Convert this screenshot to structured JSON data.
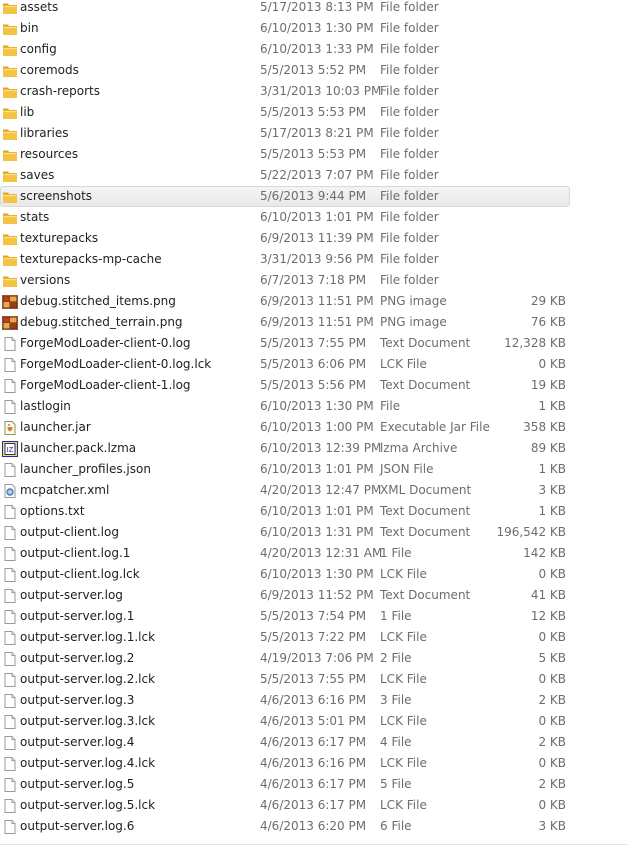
{
  "files": [
    {
      "name": "assets",
      "date": "5/17/2013 8:13 PM",
      "type": "File folder",
      "size": "",
      "icon": "folder-icon"
    },
    {
      "name": "bin",
      "date": "6/10/2013 1:30 PM",
      "type": "File folder",
      "size": "",
      "icon": "folder-icon"
    },
    {
      "name": "config",
      "date": "6/10/2013 1:33 PM",
      "type": "File folder",
      "size": "",
      "icon": "folder-icon"
    },
    {
      "name": "coremods",
      "date": "5/5/2013 5:52 PM",
      "type": "File folder",
      "size": "",
      "icon": "folder-icon"
    },
    {
      "name": "crash-reports",
      "date": "3/31/2013 10:03 PM",
      "type": "File folder",
      "size": "",
      "icon": "folder-icon"
    },
    {
      "name": "lib",
      "date": "5/5/2013 5:53 PM",
      "type": "File folder",
      "size": "",
      "icon": "folder-icon"
    },
    {
      "name": "libraries",
      "date": "5/17/2013 8:21 PM",
      "type": "File folder",
      "size": "",
      "icon": "folder-icon"
    },
    {
      "name": "resources",
      "date": "5/5/2013 5:53 PM",
      "type": "File folder",
      "size": "",
      "icon": "folder-icon"
    },
    {
      "name": "saves",
      "date": "5/22/2013 7:07 PM",
      "type": "File folder",
      "size": "",
      "icon": "folder-icon"
    },
    {
      "name": "screenshots",
      "date": "5/6/2013 9:44 PM",
      "type": "File folder",
      "size": "",
      "icon": "folder-icon",
      "selected": true
    },
    {
      "name": "stats",
      "date": "6/10/2013 1:01 PM",
      "type": "File folder",
      "size": "",
      "icon": "folder-icon"
    },
    {
      "name": "texturepacks",
      "date": "6/9/2013 11:39 PM",
      "type": "File folder",
      "size": "",
      "icon": "folder-icon"
    },
    {
      "name": "texturepacks-mp-cache",
      "date": "3/31/2013 9:56 PM",
      "type": "File folder",
      "size": "",
      "icon": "folder-icon"
    },
    {
      "name": "versions",
      "date": "6/7/2013 7:18 PM",
      "type": "File folder",
      "size": "",
      "icon": "folder-icon"
    },
    {
      "name": "debug.stitched_items.png",
      "date": "6/9/2013 11:51 PM",
      "type": "PNG image",
      "size": "29 KB",
      "icon": "image-icon"
    },
    {
      "name": "debug.stitched_terrain.png",
      "date": "6/9/2013 11:51 PM",
      "type": "PNG image",
      "size": "76 KB",
      "icon": "image-icon"
    },
    {
      "name": "ForgeModLoader-client-0.log",
      "date": "5/5/2013 7:55 PM",
      "type": "Text Document",
      "size": "12,328 KB",
      "icon": "document-icon"
    },
    {
      "name": "ForgeModLoader-client-0.log.lck",
      "date": "5/5/2013 6:06 PM",
      "type": "LCK File",
      "size": "0 KB",
      "icon": "document-icon"
    },
    {
      "name": "ForgeModLoader-client-1.log",
      "date": "5/5/2013 5:56 PM",
      "type": "Text Document",
      "size": "19 KB",
      "icon": "document-icon"
    },
    {
      "name": "lastlogin",
      "date": "6/10/2013 1:30 PM",
      "type": "File",
      "size": "1 KB",
      "icon": "document-icon"
    },
    {
      "name": "launcher.jar",
      "date": "6/10/2013 1:00 PM",
      "type": "Executable Jar File",
      "size": "358 KB",
      "icon": "jar-icon"
    },
    {
      "name": "launcher.pack.lzma",
      "date": "6/10/2013 12:39 PM",
      "type": "lzma Archive",
      "size": "89 KB",
      "icon": "archive-icon"
    },
    {
      "name": "launcher_profiles.json",
      "date": "6/10/2013 1:01 PM",
      "type": "JSON File",
      "size": "1 KB",
      "icon": "document-icon"
    },
    {
      "name": "mcpatcher.xml",
      "date": "4/20/2013 12:47 PM",
      "type": "XML Document",
      "size": "3 KB",
      "icon": "xml-icon"
    },
    {
      "name": "options.txt",
      "date": "6/10/2013 1:01 PM",
      "type": "Text Document",
      "size": "1 KB",
      "icon": "document-icon"
    },
    {
      "name": "output-client.log",
      "date": "6/10/2013 1:31 PM",
      "type": "Text Document",
      "size": "196,542 KB",
      "icon": "document-icon"
    },
    {
      "name": "output-client.log.1",
      "date": "4/20/2013 12:31 AM",
      "type": "1 File",
      "size": "142 KB",
      "icon": "document-icon"
    },
    {
      "name": "output-client.log.lck",
      "date": "6/10/2013 1:30 PM",
      "type": "LCK File",
      "size": "0 KB",
      "icon": "document-icon"
    },
    {
      "name": "output-server.log",
      "date": "6/9/2013 11:52 PM",
      "type": "Text Document",
      "size": "41 KB",
      "icon": "document-icon"
    },
    {
      "name": "output-server.log.1",
      "date": "5/5/2013 7:54 PM",
      "type": "1 File",
      "size": "12 KB",
      "icon": "document-icon"
    },
    {
      "name": "output-server.log.1.lck",
      "date": "5/5/2013 7:22 PM",
      "type": "LCK File",
      "size": "0 KB",
      "icon": "document-icon"
    },
    {
      "name": "output-server.log.2",
      "date": "4/19/2013 7:06 PM",
      "type": "2 File",
      "size": "5 KB",
      "icon": "document-icon"
    },
    {
      "name": "output-server.log.2.lck",
      "date": "5/5/2013 7:55 PM",
      "type": "LCK File",
      "size": "0 KB",
      "icon": "document-icon"
    },
    {
      "name": "output-server.log.3",
      "date": "4/6/2013 6:16 PM",
      "type": "3 File",
      "size": "2 KB",
      "icon": "document-icon"
    },
    {
      "name": "output-server.log.3.lck",
      "date": "4/6/2013 5:01 PM",
      "type": "LCK File",
      "size": "0 KB",
      "icon": "document-icon"
    },
    {
      "name": "output-server.log.4",
      "date": "4/6/2013 6:17 PM",
      "type": "4 File",
      "size": "2 KB",
      "icon": "document-icon"
    },
    {
      "name": "output-server.log.4.lck",
      "date": "4/6/2013 6:16 PM",
      "type": "LCK File",
      "size": "0 KB",
      "icon": "document-icon"
    },
    {
      "name": "output-server.log.5",
      "date": "4/6/2013 6:17 PM",
      "type": "5 File",
      "size": "2 KB",
      "icon": "document-icon"
    },
    {
      "name": "output-server.log.5.lck",
      "date": "4/6/2013 6:17 PM",
      "type": "LCK File",
      "size": "0 KB",
      "icon": "document-icon"
    },
    {
      "name": "output-server.log.6",
      "date": "4/6/2013 6:20 PM",
      "type": "6 File",
      "size": "3 KB",
      "icon": "document-icon"
    }
  ],
  "colors": {
    "folder_body": "#f5c343",
    "folder_tab": "#e1a524",
    "selection_border": "#d9d9d9",
    "secondary_text": "#6d6d6d"
  }
}
